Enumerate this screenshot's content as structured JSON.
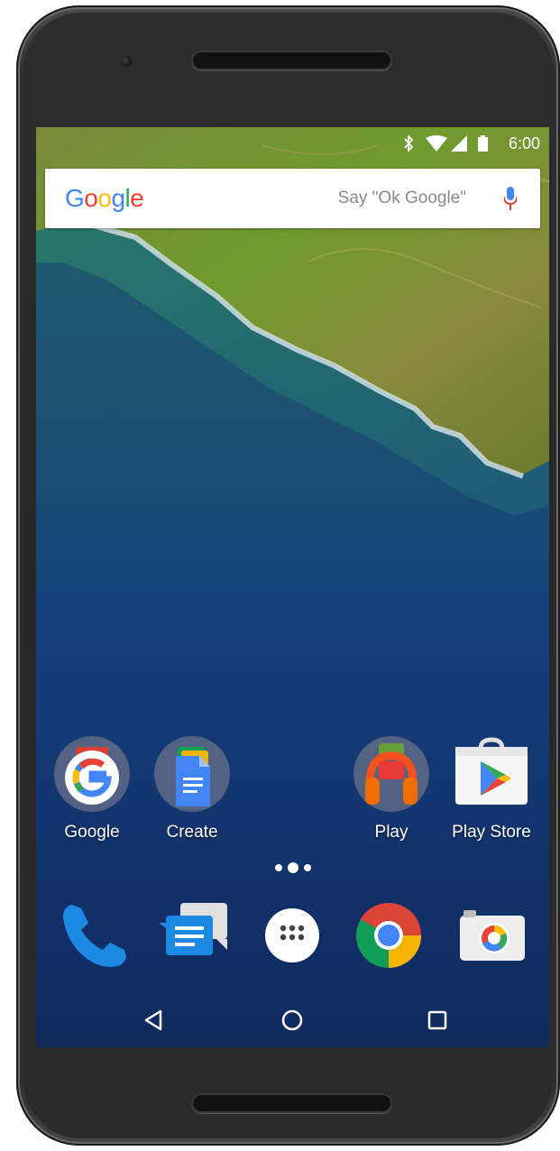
{
  "status_bar": {
    "time": "6:00",
    "icons": [
      "bluetooth-icon",
      "wifi-icon",
      "signal-icon",
      "battery-icon"
    ]
  },
  "search": {
    "logo": "Google",
    "hint": "Say \"Ok Google\"",
    "icon": "mic-icon"
  },
  "home_apps": [
    {
      "label": "Google",
      "icon": "google-folder-icon"
    },
    {
      "label": "Create",
      "icon": "create-folder-icon"
    },
    {
      "label": "Play",
      "icon": "play-folder-icon"
    },
    {
      "label": "Play Store",
      "icon": "play-store-icon"
    }
  ],
  "dock": [
    {
      "name": "Phone",
      "icon": "phone-icon"
    },
    {
      "name": "Messenger",
      "icon": "messenger-icon"
    },
    {
      "name": "Apps",
      "icon": "app-drawer-icon"
    },
    {
      "name": "Chrome",
      "icon": "chrome-icon"
    },
    {
      "name": "Camera",
      "icon": "camera-icon"
    }
  ],
  "nav": [
    "back-icon",
    "home-icon",
    "recents-icon"
  ],
  "colors": {
    "google_blue": "#4285F4",
    "google_red": "#EA4335",
    "google_yellow": "#FBBC05",
    "google_green": "#34A853"
  }
}
